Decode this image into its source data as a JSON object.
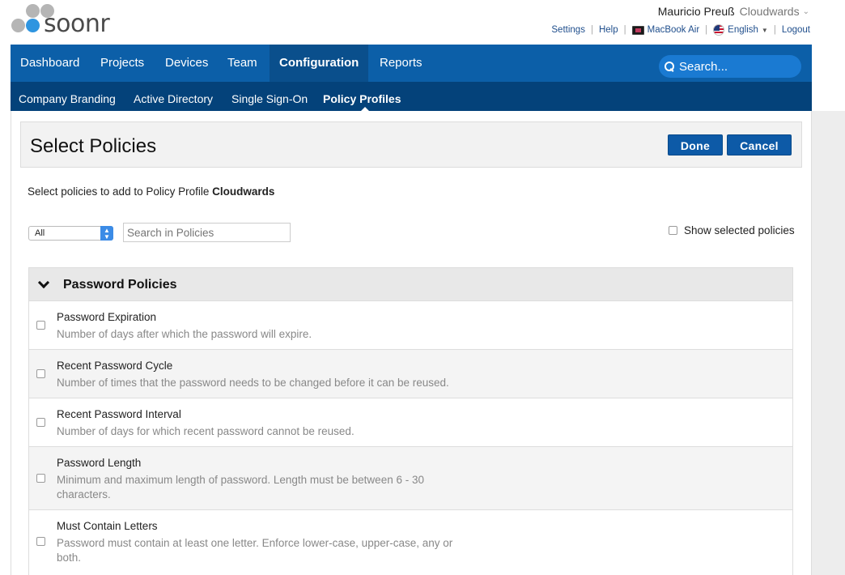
{
  "header": {
    "logo_text": "soonr",
    "user_name": "Mauricio Preuß",
    "account_name": "Cloudwards",
    "links": {
      "settings": "Settings",
      "help": "Help",
      "device": "MacBook Air",
      "language": "English",
      "logout": "Logout"
    }
  },
  "main_nav": {
    "tabs": [
      {
        "label": "Dashboard"
      },
      {
        "label": "Projects"
      },
      {
        "label": "Devices"
      },
      {
        "label": "Team"
      },
      {
        "label": "Configuration"
      },
      {
        "label": "Reports"
      }
    ],
    "active": "Configuration",
    "search_label": "Search..."
  },
  "sub_nav": {
    "tabs": [
      {
        "label": "Company Branding"
      },
      {
        "label": "Active Directory"
      },
      {
        "label": "Single Sign-On"
      },
      {
        "label": "Policy Profiles"
      }
    ],
    "active": "Policy Profiles"
  },
  "page": {
    "title": "Select Policies",
    "done_label": "Done",
    "cancel_label": "Cancel",
    "intro_text": "Select policies to add to Policy Profile",
    "profile_name": "Cloudwards",
    "filter_value": "All",
    "search_placeholder": "Search in Policies",
    "show_selected_label": "Show selected policies"
  },
  "group": {
    "title": "Password Policies",
    "policies": [
      {
        "title": "Password Expiration",
        "description": "Number of days after which the password will expire.",
        "checked": false
      },
      {
        "title": "Recent Password Cycle",
        "description": "Number of times that the password needs to be changed before it can be reused.",
        "checked": false
      },
      {
        "title": "Recent Password Interval",
        "description": "Number of days for which recent password cannot be reused.",
        "checked": false
      },
      {
        "title": "Password Length",
        "description": "Minimum and maximum length of password. Length must be between 6 - 30 characters.",
        "checked": false
      },
      {
        "title": "Must Contain Letters",
        "description": "Password must contain at least one letter. Enforce lower-case, upper-case, any or both.",
        "checked": false
      }
    ]
  },
  "colors": {
    "nav_blue": "#0c5fa8",
    "subnav_blue": "#04427a",
    "button_blue": "#0d5aa7",
    "logo_gray": "#b5b5b5",
    "logo_blue": "#2f95e0"
  }
}
